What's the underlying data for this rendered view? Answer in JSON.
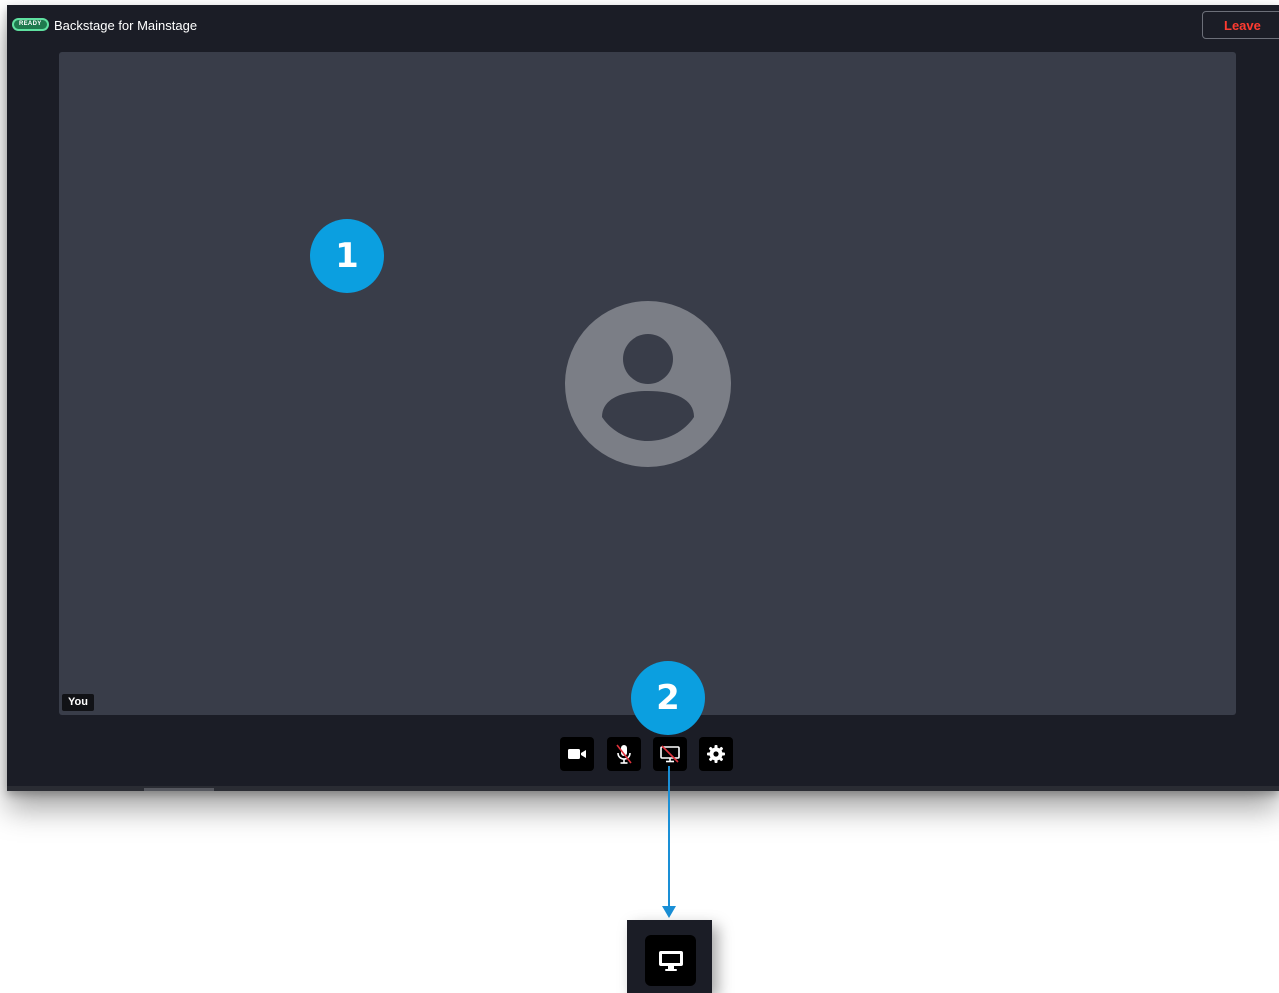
{
  "header": {
    "status_badge": "READY",
    "room_title": "Backstage for Mainstage",
    "leave_label": "Leave"
  },
  "stage": {
    "participant_label": "You"
  },
  "controls": [
    {
      "name": "camera-button",
      "icon": "video-camera-icon"
    },
    {
      "name": "microphone-button",
      "icon": "microphone-muted-icon"
    },
    {
      "name": "screen-share-button",
      "icon": "screen-share-off-icon"
    },
    {
      "name": "settings-button",
      "icon": "gear-icon"
    }
  ],
  "callouts": {
    "one": "1",
    "two": "2"
  },
  "zoom_inset": {
    "icon": "screen-share-icon"
  },
  "colors": {
    "leave_text": "#ff3b30",
    "ready_badge": "#5fe0a0",
    "callout": "#0b9fe0",
    "stage_bg": "#393d49",
    "app_bg": "#1b1d26"
  }
}
